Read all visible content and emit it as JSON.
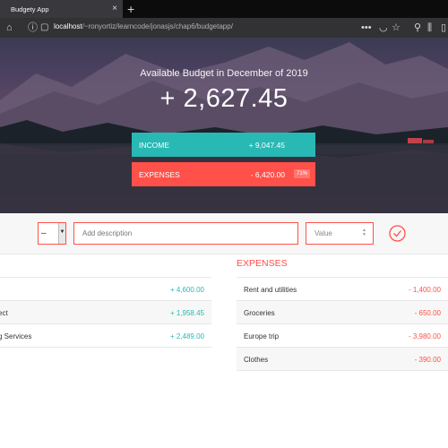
{
  "browser": {
    "tab_title": "Budgety App",
    "new_tab_icon": "+",
    "url_host": "localhost",
    "url_path": "/~ronyortiz/learncode/jonasjs/chap6/budgetapp/"
  },
  "budget": {
    "title": "Available Budget in December of 2019",
    "value": "+ 2,627.45",
    "income_label": "Income",
    "income_value": "+ 9,047.45",
    "expenses_label": "Expenses",
    "expenses_value": "- 6,420.00",
    "expenses_percentage": "71%"
  },
  "form": {
    "type_value": "–",
    "description_placeholder": "Add description",
    "value_placeholder": "Value"
  },
  "income": [
    {
      "description": "",
      "value": "+ 4,600.00"
    },
    {
      "description": "ect",
      "value": "+ 1,958.45"
    },
    {
      "description": "g Services",
      "value": "+ 2,489.00"
    }
  ],
  "expenses_title": "EXPENSES",
  "expenses": [
    {
      "description": "Rent and utilities",
      "value": "- 1,400.00"
    },
    {
      "description": "Groceries",
      "value": "- 650.00"
    },
    {
      "description": "Europe trip",
      "value": "- 3,980.00"
    },
    {
      "description": "Clothes",
      "value": "- 390.00"
    }
  ],
  "colors": {
    "income": "#28b9b5",
    "expenses": "#ff5049"
  }
}
